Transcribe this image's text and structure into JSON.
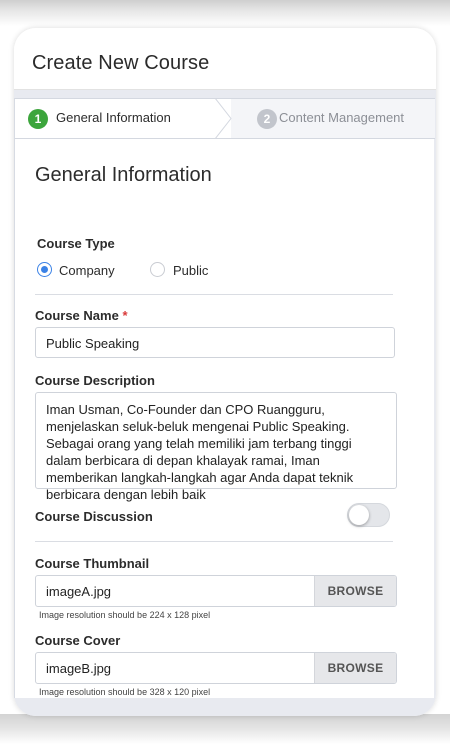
{
  "header": {
    "title": "Create New Course"
  },
  "stepper": {
    "steps": [
      {
        "number": "1",
        "label": "General Information",
        "active": true
      },
      {
        "number": "2",
        "label": "Content Management",
        "active": false
      }
    ]
  },
  "form": {
    "section_title": "General Information",
    "course_type": {
      "label": "Course Type",
      "options": [
        "Company",
        "Public"
      ],
      "selected": "Company"
    },
    "course_name": {
      "label": "Course Name",
      "required_mark": "*",
      "value": "Public Speaking"
    },
    "course_description": {
      "label": "Course Description",
      "value": "Iman Usman, Co-Founder dan CPO Ruangguru, menjelaskan seluk-beluk mengenai Public Speaking. Sebagai orang yang telah memiliki jam terbang tinggi dalam berbicara di depan khalayak ramai, Iman memberikan langkah-langkah agar Anda dapat teknik berbicara dengan lebih baik"
    },
    "course_discussion": {
      "label": "Course Discussion",
      "enabled": false
    },
    "course_thumbnail": {
      "label": "Course Thumbnail",
      "file": "imageA.jpg",
      "button": "BROWSE",
      "hint": "Image resolution should be 224 x 128 pixel"
    },
    "course_cover": {
      "label": "Course Cover",
      "file": "imageB.jpg",
      "button": "BROWSE",
      "hint": "Image resolution should be 328 x 120 pixel"
    }
  },
  "colors": {
    "accent": "#3b82e6",
    "step_active": "#3ca53c",
    "step_inactive": "#c2c5cc",
    "required": "#d93a3a",
    "background": "#e8eaf0"
  }
}
